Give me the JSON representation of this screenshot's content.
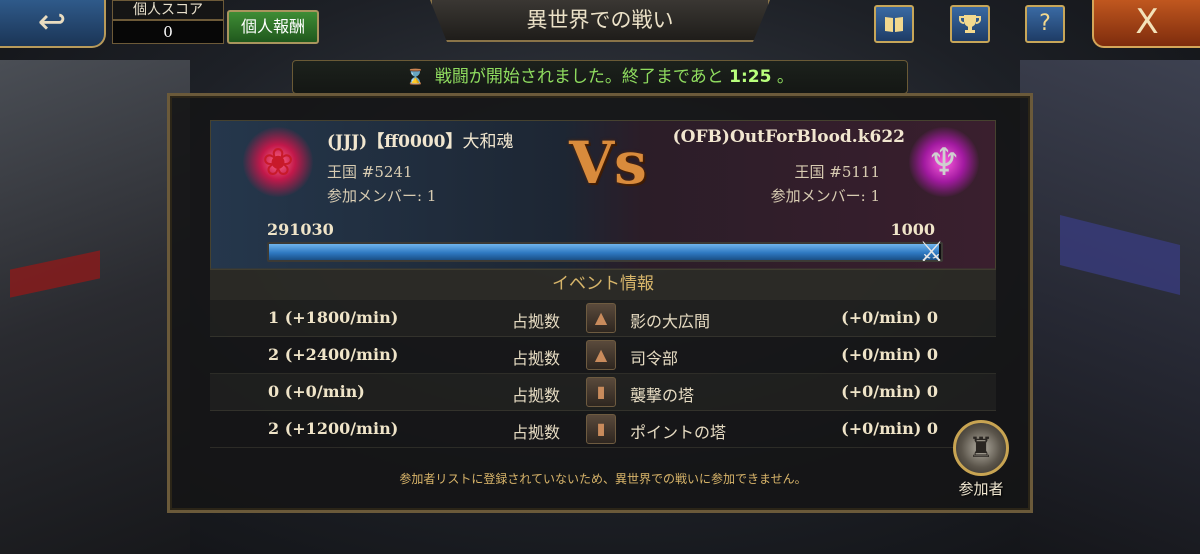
{
  "header": {
    "score_label": "個人スコア",
    "score_value": "0",
    "reward_button": "個人報酬",
    "title": "異世界での戦い",
    "icons": [
      "book-icon",
      "trophy-icon",
      "help-icon"
    ],
    "help_glyph": "?",
    "close_glyph": "X"
  },
  "status": {
    "message": "戦闘が開始されました。終了まであと",
    "time": "1:25",
    "suffix": "。"
  },
  "matchup": {
    "vs": "Vs",
    "left": {
      "name_tag": "(JJJ)【ff0000】",
      "name_rest": "大和魂",
      "kingdom": "王国 #5241",
      "members": "参加メンバー: 1",
      "score": "291030",
      "emblem": "rose-emblem-icon"
    },
    "right": {
      "name": "(OFB)OutForBlood.k622",
      "kingdom": "王国 #5111",
      "members": "参加メンバー: 1",
      "score": "1000",
      "emblem": "demon-emblem-icon"
    },
    "progress_fraction": 0.9966
  },
  "event_info": {
    "title": "イベント情報",
    "rows": [
      {
        "left": "1 (+1800/min)",
        "label": "占拠数",
        "building": "影の大広間",
        "right": "(+0/min) 0"
      },
      {
        "left": "2 (+2400/min)",
        "label": "占拠数",
        "building": "司令部",
        "right": "(+0/min) 0"
      },
      {
        "left": "0 (+0/min)",
        "label": "占拠数",
        "building": "襲撃の塔",
        "right": "(+0/min) 0"
      },
      {
        "left": "2 (+1200/min)",
        "label": "占拠数",
        "building": "ポイントの塔",
        "right": "(+0/min) 0"
      }
    ]
  },
  "notice": "参加者リストに登録されていないため、異世界での戦いに参加できません。",
  "participants_button": "参加者",
  "colors": {
    "status_text": "#8fdc5f",
    "bar_fill": "#2f79c2",
    "vs": "#d98b3c",
    "notice": "#d9b56a"
  }
}
